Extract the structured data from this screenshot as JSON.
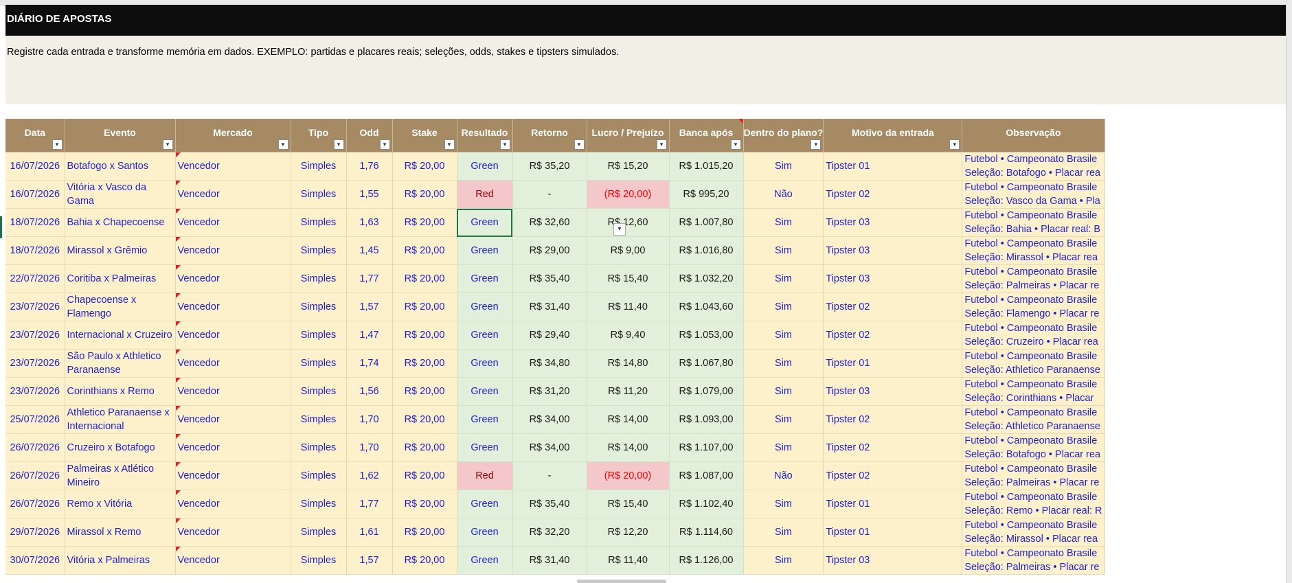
{
  "sheet": {
    "title": "DIÁRIO DE APOSTAS",
    "description": "Registre cada entrada e transforme memória em dados. EXEMPLO: partidas e placares reais; seleções, odds, stakes e tipsters simulados."
  },
  "columns": [
    "Data",
    "Evento",
    "Mercado",
    "Tipo",
    "Odd",
    "Stake",
    "Resultado",
    "Retorno",
    "Lucro / Prejuízo",
    "Banca após",
    "Dentro do plano?",
    "Motivo da entrada",
    "Observação"
  ],
  "rows": [
    {
      "data": "16/07/2026",
      "evento": "Botafogo x Santos",
      "mercado": "Vencedor",
      "tipo": "Simples",
      "odd": "1,76",
      "stake": "R$ 20,00",
      "resultado": "Green",
      "retorno": "R$ 35,20",
      "lucro": "R$ 15,20",
      "banca": "R$ 1.015,20",
      "plano": "Sim",
      "motivo": "Tipster 01",
      "obs1": "Futebol • Campeonato Brasile",
      "obs2": "Seleção: Botafogo • Placar rea"
    },
    {
      "data": "16/07/2026",
      "evento": "Vitória x Vasco da Gama",
      "mercado": "Vencedor",
      "tipo": "Simples",
      "odd": "1,55",
      "stake": "R$ 20,00",
      "resultado": "Red",
      "retorno": "-",
      "lucro": "(R$ 20,00)",
      "banca": "R$ 995,20",
      "plano": "Não",
      "motivo": "Tipster 02",
      "obs1": "Futebol • Campeonato Brasile",
      "obs2": "Seleção: Vasco da Gama • Pla"
    },
    {
      "data": "18/07/2026",
      "evento": "Bahia x Chapecoense",
      "mercado": "Vencedor",
      "tipo": "Simples",
      "odd": "1,63",
      "stake": "R$ 20,00",
      "resultado": "Green",
      "retorno": "R$ 32,60",
      "lucro": "R$ 12,60",
      "banca": "R$ 1.007,80",
      "plano": "Sim",
      "motivo": "Tipster 03",
      "obs1": "Futebol • Campeonato Brasile",
      "obs2": "Seleção: Bahia • Placar real: B"
    },
    {
      "data": "18/07/2026",
      "evento": "Mirassol x Grêmio",
      "mercado": "Vencedor",
      "tipo": "Simples",
      "odd": "1,45",
      "stake": "R$ 20,00",
      "resultado": "Green",
      "retorno": "R$ 29,00",
      "lucro": "R$ 9,00",
      "banca": "R$ 1.016,80",
      "plano": "Sim",
      "motivo": "Tipster 03",
      "obs1": "Futebol • Campeonato Brasile",
      "obs2": "Seleção: Mirassol • Placar rea"
    },
    {
      "data": "22/07/2026",
      "evento": "Coritiba x Palmeiras",
      "mercado": "Vencedor",
      "tipo": "Simples",
      "odd": "1,77",
      "stake": "R$ 20,00",
      "resultado": "Green",
      "retorno": "R$ 35,40",
      "lucro": "R$ 15,40",
      "banca": "R$ 1.032,20",
      "plano": "Sim",
      "motivo": "Tipster 03",
      "obs1": "Futebol • Campeonato Brasile",
      "obs2": "Seleção: Palmeiras • Placar re"
    },
    {
      "data": "23/07/2026",
      "evento": "Chapecoense x Flamengo",
      "mercado": "Vencedor",
      "tipo": "Simples",
      "odd": "1,57",
      "stake": "R$ 20,00",
      "resultado": "Green",
      "retorno": "R$ 31,40",
      "lucro": "R$ 11,40",
      "banca": "R$ 1.043,60",
      "plano": "Sim",
      "motivo": "Tipster 02",
      "obs1": "Futebol • Campeonato Brasile",
      "obs2": "Seleção: Flamengo • Placar re"
    },
    {
      "data": "23/07/2026",
      "evento": "Internacional x Cruzeiro",
      "mercado": "Vencedor",
      "tipo": "Simples",
      "odd": "1,47",
      "stake": "R$ 20,00",
      "resultado": "Green",
      "retorno": "R$ 29,40",
      "lucro": "R$ 9,40",
      "banca": "R$ 1.053,00",
      "plano": "Sim",
      "motivo": "Tipster 02",
      "obs1": "Futebol • Campeonato Brasile",
      "obs2": "Seleção: Cruzeiro • Placar rea"
    },
    {
      "data": "23/07/2026",
      "evento": "São Paulo x Athletico Paranaense",
      "mercado": "Vencedor",
      "tipo": "Simples",
      "odd": "1,74",
      "stake": "R$ 20,00",
      "resultado": "Green",
      "retorno": "R$ 34,80",
      "lucro": "R$ 14,80",
      "banca": "R$ 1.067,80",
      "plano": "Sim",
      "motivo": "Tipster 01",
      "obs1": "Futebol • Campeonato Brasile",
      "obs2": "Seleção: Athletico Paranaense"
    },
    {
      "data": "23/07/2026",
      "evento": "Corinthians x Remo",
      "mercado": "Vencedor",
      "tipo": "Simples",
      "odd": "1,56",
      "stake": "R$ 20,00",
      "resultado": "Green",
      "retorno": "R$ 31,20",
      "lucro": "R$ 11,20",
      "banca": "R$ 1.079,00",
      "plano": "Sim",
      "motivo": "Tipster 03",
      "obs1": "Futebol • Campeonato Brasile",
      "obs2": "Seleção: Corinthians • Placar"
    },
    {
      "data": "25/07/2026",
      "evento": "Athletico Paranaense x Internacional",
      "mercado": "Vencedor",
      "tipo": "Simples",
      "odd": "1,70",
      "stake": "R$ 20,00",
      "resultado": "Green",
      "retorno": "R$ 34,00",
      "lucro": "R$ 14,00",
      "banca": "R$ 1.093,00",
      "plano": "Sim",
      "motivo": "Tipster 02",
      "obs1": "Futebol • Campeonato Brasile",
      "obs2": "Seleção: Athletico Paranaense"
    },
    {
      "data": "26/07/2026",
      "evento": "Cruzeiro x Botafogo",
      "mercado": "Vencedor",
      "tipo": "Simples",
      "odd": "1,70",
      "stake": "R$ 20,00",
      "resultado": "Green",
      "retorno": "R$ 34,00",
      "lucro": "R$ 14,00",
      "banca": "R$ 1.107,00",
      "plano": "Sim",
      "motivo": "Tipster 02",
      "obs1": "Futebol • Campeonato Brasile",
      "obs2": "Seleção: Botafogo • Placar rea"
    },
    {
      "data": "26/07/2026",
      "evento": "Palmeiras x Atlético Mineiro",
      "mercado": "Vencedor",
      "tipo": "Simples",
      "odd": "1,62",
      "stake": "R$ 20,00",
      "resultado": "Red",
      "retorno": "-",
      "lucro": "(R$ 20,00)",
      "banca": "R$ 1.087,00",
      "plano": "Não",
      "motivo": "Tipster 02",
      "obs1": "Futebol • Campeonato Brasile",
      "obs2": "Seleção: Palmeiras • Placar re"
    },
    {
      "data": "26/07/2026",
      "evento": "Remo x Vitória",
      "mercado": "Vencedor",
      "tipo": "Simples",
      "odd": "1,77",
      "stake": "R$ 20,00",
      "resultado": "Green",
      "retorno": "R$ 35,40",
      "lucro": "R$ 15,40",
      "banca": "R$ 1.102,40",
      "plano": "Sim",
      "motivo": "Tipster 01",
      "obs1": "Futebol • Campeonato Brasile",
      "obs2": "Seleção: Remo • Placar real: R"
    },
    {
      "data": "29/07/2026",
      "evento": "Mirassol x Remo",
      "mercado": "Vencedor",
      "tipo": "Simples",
      "odd": "1,61",
      "stake": "R$ 20,00",
      "resultado": "Green",
      "retorno": "R$ 32,20",
      "lucro": "R$ 12,20",
      "banca": "R$ 1.114,60",
      "plano": "Sim",
      "motivo": "Tipster 01",
      "obs1": "Futebol • Campeonato Brasile",
      "obs2": "Seleção: Mirassol • Placar rea"
    },
    {
      "data": "30/07/2026",
      "evento": "Vitória x Palmeiras",
      "mercado": "Vencedor",
      "tipo": "Simples",
      "odd": "1,57",
      "stake": "R$ 20,00",
      "resultado": "Green",
      "retorno": "R$ 31,40",
      "lucro": "R$ 11,40",
      "banca": "R$ 1.126,00",
      "plano": "Sim",
      "motivo": "Tipster 03",
      "obs1": "Futebol • Campeonato Brasile",
      "obs2": "Seleção: Palmeiras • Placar re"
    }
  ],
  "selected_cell": {
    "row": 3,
    "column": "Resultado"
  },
  "colors": {
    "title_bg": "#0d0d0d",
    "header_bg": "#a68a64",
    "row_bg": "#fdf1cc",
    "green_bg": "#e2efda",
    "red_bg": "#f4c7cb",
    "text_blue": "#1f1fcf"
  },
  "icons": {
    "filter": "filter-dropdown-icon",
    "comment": "comment-indicator-icon"
  }
}
